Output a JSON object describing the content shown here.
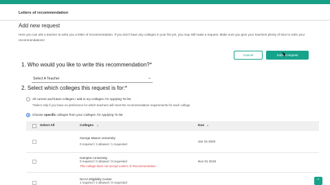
{
  "breadcrumb": "Letters of recommendation",
  "page_title": "Add new request",
  "intro_text": "Here you can ask a teacher to write you a letter of recommendation. If you don't have any colleges in your list yet, you may still make a request. Make sure you give your teachers plenty of time to write your recommendations!",
  "buttons": {
    "cancel": "Cancel",
    "submit": "Submit request"
  },
  "question1": "1. Who would you like to write this recommendation?*",
  "teacher_select": {
    "value": "Select A Teacher",
    "chevron": "⌄"
  },
  "question2": "2. Select which colleges this request is for:*",
  "option_all": {
    "prefix": "All current and future colleges I add to my ",
    "link": "Colleges I'm Applying To",
    "suffix": " list",
    "note": "*Select only if you have no preference for which teachers will meet the recommendation requirements for each college"
  },
  "option_specific": {
    "prefix": "Choose ",
    "bold": "specific",
    "mid": " colleges from your ",
    "link": "Colleges I'm Applying To",
    "suffix": " list"
  },
  "table": {
    "headers": {
      "select_all": "Select All",
      "colleges": "Colleges",
      "due": "Due"
    },
    "sort_icon": "⌄",
    "rows": [
      {
        "name": "George Mason University",
        "stats": "0 required / 2 allowed / 1 requested",
        "warning": "",
        "due": "Jan 15 2020"
      },
      {
        "name": "Hampton University",
        "stats": "0 required / 0 allowed / 0 requested",
        "warning": "This college does not accept Letters of Recommendation",
        "due": "Nov 01 2019"
      },
      {
        "name": "NCAA Eligibility Center",
        "stats": "1 required / 2 allowed / 0 requested",
        "warning": "",
        "due": ""
      }
    ]
  },
  "scroll_top_icon": "⌃",
  "colors": {
    "accent": "#17a38b",
    "warning": "#dd4444"
  }
}
